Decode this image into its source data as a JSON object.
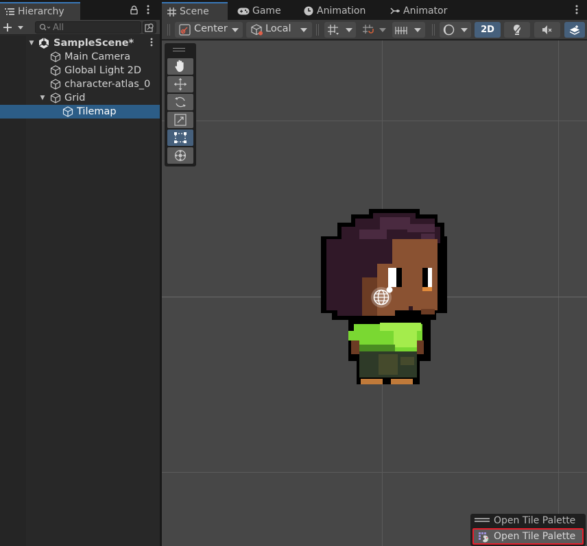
{
  "hierarchy": {
    "tab_label": "Hierarchy",
    "search_placeholder": "All",
    "items": [
      {
        "label": "SampleScene*",
        "type": "scene"
      },
      {
        "label": "Main Camera",
        "type": "gameobject"
      },
      {
        "label": "Global Light 2D",
        "type": "gameobject"
      },
      {
        "label": "character-atlas_0",
        "type": "gameobject"
      },
      {
        "label": "Grid",
        "type": "gameobject"
      },
      {
        "label": "Tilemap",
        "type": "gameobject",
        "selected": true
      }
    ]
  },
  "scene_window": {
    "tabs": [
      {
        "label": "Scene",
        "icon": "grid-icon",
        "active": true
      },
      {
        "label": "Game",
        "icon": "gamepad-icon"
      },
      {
        "label": "Animation",
        "icon": "clock-icon"
      },
      {
        "label": "Animator",
        "icon": "animator-icon"
      }
    ],
    "toolbar": {
      "pivot_mode": "Center",
      "pivot_rotation": "Local",
      "view_2d_label": "2D"
    }
  },
  "tile_palette": {
    "header_label": "Open Tile Palette",
    "button_label": "Open Tile Palette"
  },
  "colors": {
    "selection": "#2c5d87",
    "accent_tab": "#3a79bb",
    "highlight_border": "#e81e2b",
    "active_tool": "#46607c"
  }
}
